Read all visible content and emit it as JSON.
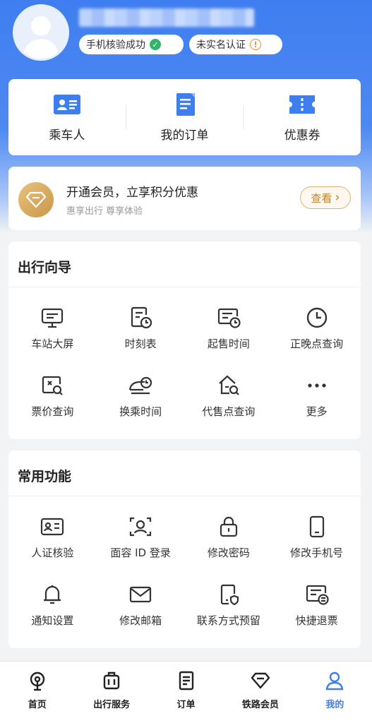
{
  "profile": {
    "badge_phone": "手机核验成功",
    "badge_realname": "未实名认证",
    "avatar_icon": "user-avatar-icon"
  },
  "quick": [
    {
      "label": "乘车人",
      "icon": "passenger-card-icon"
    },
    {
      "label": "我的订单",
      "icon": "order-doc-icon"
    },
    {
      "label": "优惠券",
      "icon": "coupon-icon"
    }
  ],
  "vip": {
    "title": "开通会员，立享积分优惠",
    "subtitle": "惠享出行 尊享体验",
    "button": "查看",
    "button_chevron": "›"
  },
  "travel_guide": {
    "title": "出行向导",
    "items": [
      {
        "label": "车站大屏",
        "icon": "station-screen-icon"
      },
      {
        "label": "时刻表",
        "icon": "timetable-icon"
      },
      {
        "label": "起售时间",
        "icon": "sale-time-icon"
      },
      {
        "label": "正晚点查询",
        "icon": "clock-icon"
      },
      {
        "label": "票价查询",
        "icon": "fare-search-icon"
      },
      {
        "label": "换乘时间",
        "icon": "transfer-time-icon"
      },
      {
        "label": "代售点查询",
        "icon": "agency-search-icon"
      },
      {
        "label": "更多",
        "icon": "more-dots-icon"
      }
    ]
  },
  "common": {
    "title": "常用功能",
    "items": [
      {
        "label": "人证核验",
        "icon": "id-card-icon"
      },
      {
        "label": "面容 ID 登录",
        "icon": "face-id-icon"
      },
      {
        "label": "修改密码",
        "icon": "lock-icon"
      },
      {
        "label": "修改手机号",
        "icon": "phone-icon"
      },
      {
        "label": "通知设置",
        "icon": "bell-icon"
      },
      {
        "label": "修改邮箱",
        "icon": "mail-icon"
      },
      {
        "label": "联系方式预留",
        "icon": "contact-reserve-icon"
      },
      {
        "label": "快捷退票",
        "icon": "quick-refund-icon"
      }
    ]
  },
  "tabs": [
    {
      "label": "首页",
      "icon": "home-train-icon",
      "active": false
    },
    {
      "label": "出行服务",
      "icon": "luggage-icon",
      "active": false
    },
    {
      "label": "订单",
      "icon": "order-icon",
      "active": false
    },
    {
      "label": "铁路会员",
      "icon": "diamond-icon",
      "active": false
    },
    {
      "label": "我的",
      "icon": "user-icon",
      "active": true
    }
  ],
  "colors": {
    "accent": "#3f7ef0",
    "gold": "#c9974a",
    "success": "#34b36b",
    "warning": "#f08a24"
  }
}
